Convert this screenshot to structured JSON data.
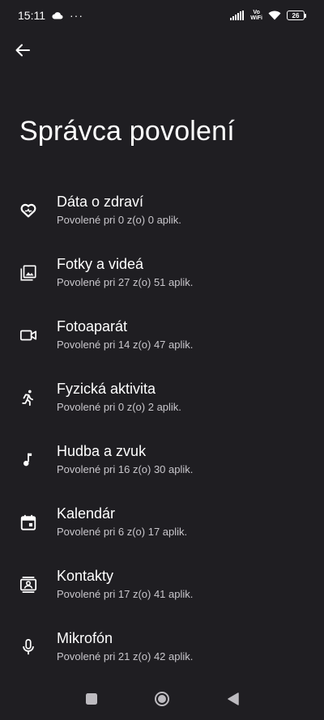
{
  "status_bar": {
    "time": "15:11",
    "more": "···",
    "vowifi_top": "Vo",
    "vowifi_bottom": "WiFi",
    "battery": "26"
  },
  "header": {
    "title": "Správca povolení"
  },
  "items": [
    {
      "icon": "health-icon",
      "title": "Dáta o zdraví",
      "subtitle": "Povolené pri 0 z(o) 0 aplik."
    },
    {
      "icon": "photos-icon",
      "title": "Fotky a videá",
      "subtitle": "Povolené pri 27 z(o) 51 aplik."
    },
    {
      "icon": "camera-icon",
      "title": "Fotoaparát",
      "subtitle": "Povolené pri 14 z(o) 47 aplik."
    },
    {
      "icon": "activity-icon",
      "title": "Fyzická aktivita",
      "subtitle": "Povolené pri 0 z(o) 2 aplik."
    },
    {
      "icon": "music-icon",
      "title": "Hudba a zvuk",
      "subtitle": "Povolené pri 16 z(o) 30 aplik."
    },
    {
      "icon": "calendar-icon",
      "title": "Kalendár",
      "subtitle": "Povolené pri 6 z(o) 17 aplik."
    },
    {
      "icon": "contacts-icon",
      "title": "Kontakty",
      "subtitle": "Povolené pri 17 z(o) 41 aplik."
    },
    {
      "icon": "microphone-icon",
      "title": "Mikrofón",
      "subtitle": "Povolené pri 21 z(o) 42 aplik."
    }
  ],
  "colors": {
    "background": "#1f1e22",
    "text_primary": "#ffffff",
    "text_secondary": "#c9c7cc"
  }
}
